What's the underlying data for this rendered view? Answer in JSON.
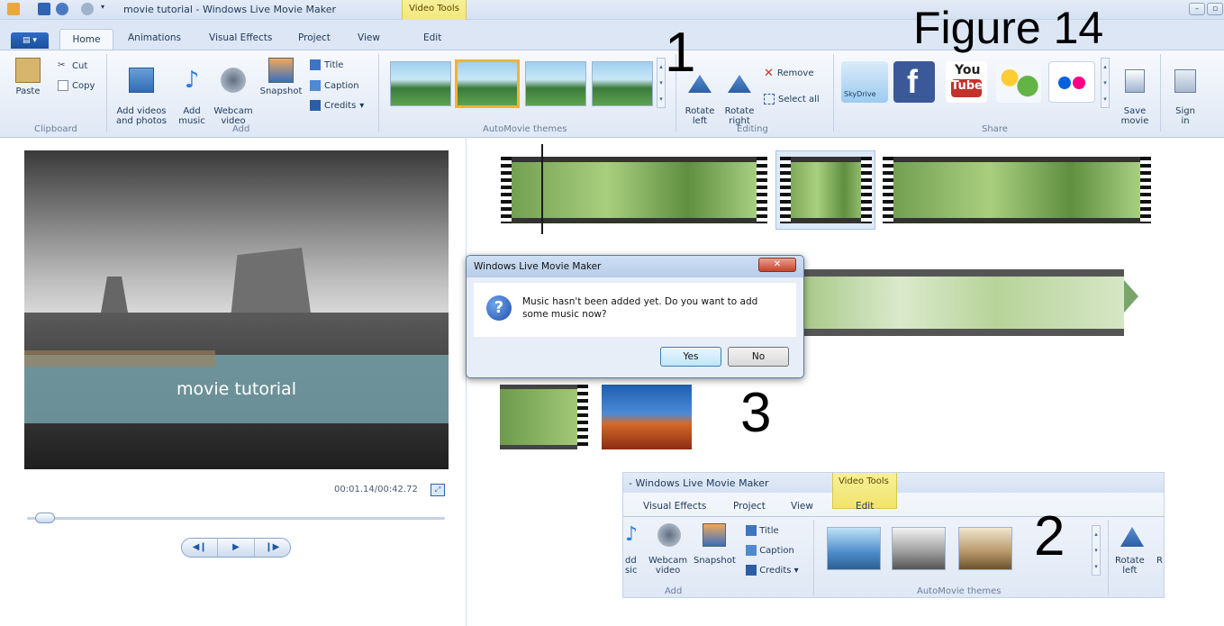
{
  "window": {
    "title": "movie tutorial - Windows Live Movie Maker",
    "contextual_tab_group": "Video Tools"
  },
  "tabs": [
    "Home",
    "Animations",
    "Visual Effects",
    "Project",
    "View",
    "Edit"
  ],
  "ribbon": {
    "clipboard": {
      "paste": "Paste",
      "cut": "Cut",
      "copy": "Copy",
      "group": "Clipboard"
    },
    "add": {
      "add_videos": "Add videos\nand photos",
      "add_music": "Add\nmusic",
      "webcam": "Webcam\nvideo",
      "snapshot": "Snapshot",
      "title": "Title",
      "caption": "Caption",
      "credits": "Credits",
      "group": "Add"
    },
    "themes_group": "AutoMovie themes",
    "editing": {
      "rotate_left": "Rotate\nleft",
      "rotate_right": "Rotate\nright",
      "remove": "Remove",
      "select_all": "Select all",
      "group": "Editing"
    },
    "share": {
      "skydrive": "SkyDrive",
      "facebook": "f",
      "youtube_top": "You",
      "youtube_bottom": "Tube",
      "save_movie": "Save\nmovie",
      "sign_in": "Sign\nin",
      "group": "Share"
    }
  },
  "preview": {
    "caption": "movie tutorial",
    "time": "00:01.14/00:42.72",
    "seek_position": 0.02
  },
  "dialog": {
    "title": "Windows Live Movie Maker",
    "message": "Music hasn't been added yet. Do you want to add some music now?",
    "yes": "Yes",
    "no": "No"
  },
  "annotations": {
    "figure": "Figure 14",
    "n1": "1",
    "n2": "2",
    "n3": "3"
  },
  "inset": {
    "title": "- Windows Live Movie Maker",
    "contextual": "Video Tools",
    "tabs": [
      "Visual Effects",
      "Project",
      "View",
      "Edit"
    ],
    "add_music_partial": "dd\nsic",
    "webcam": "Webcam\nvideo",
    "snapshot": "Snapshot",
    "title_btn": "Title",
    "caption_btn": "Caption",
    "credits_btn": "Credits",
    "add_group": "Add",
    "themes_group": "AutoMovie themes",
    "rotate_left": "Rotate\nleft",
    "rotate_right_partial": "R"
  },
  "colors": {
    "accent_blue": "#1f4fa8",
    "contextual_yellow": "#f2e36b",
    "selected_theme": "#f0b23a"
  }
}
